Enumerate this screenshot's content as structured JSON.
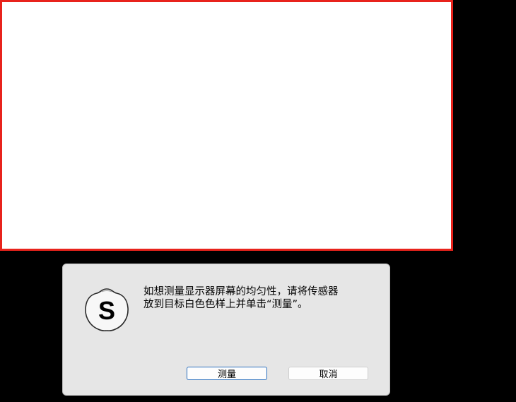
{
  "measurement_target": {
    "color": "#ffffff",
    "border_color": "#e8231c"
  },
  "dialog": {
    "logo_icon": "spyder-s-logo-icon",
    "logo_letter": "S",
    "message": "如想测量显示器屏幕的均匀性，请将传感器\n放到目标白色色样上并单击“测量”。",
    "measure_button": "测量",
    "cancel_button": "取消",
    "primary_border_color": "#2a6fbd"
  }
}
